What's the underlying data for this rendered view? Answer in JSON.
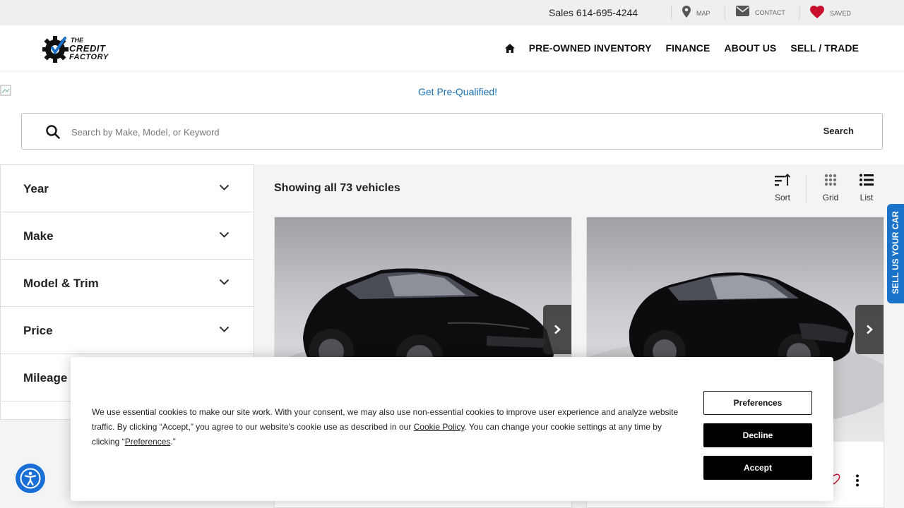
{
  "topbar": {
    "sales_text": "Sales 614-695-4244",
    "map_label": "MAP",
    "contact_label": "CONTACT",
    "saved_label": "SAVED"
  },
  "header": {
    "logo_line1": "THE",
    "logo_line2": "CREDIT",
    "logo_line3": "FACTORY",
    "nav": [
      "PRE-OWNED INVENTORY",
      "FINANCE",
      "ABOUT US",
      "SELL / TRADE"
    ]
  },
  "promo": {
    "text": "Get Pre-Qualified!"
  },
  "search": {
    "placeholder": "Search by Make, Model, or Keyword",
    "button_label": "Search"
  },
  "facets": [
    "Year",
    "Make",
    "Model & Trim",
    "Price",
    "Mileage"
  ],
  "results": {
    "showing_text": "Showing all 73 vehicles",
    "sort_label": "Sort",
    "grid_label": "Grid",
    "list_label": "List"
  },
  "sidetab": {
    "label": "SELL US YOUR CAR"
  },
  "cookie": {
    "text_part1": "We use essential cookies to make our site work. With your consent, we may also use non-essential cookies to improve user experience and analyze website traffic. By clicking “Accept,” you agree to our website's cookie use as described in our ",
    "policy_link": "Cookie Policy",
    "text_part2": ". You can change your cookie settings at any time by clicking “",
    "preferences_link": "Preferences",
    "text_part3": ".”",
    "preferences_button": "Preferences",
    "decline_button": "Decline",
    "accept_button": "Accept"
  },
  "colors": {
    "accent_blue": "#1a73c9",
    "promo_link": "#1a6fb3",
    "saved_heart": "#c8102e"
  }
}
